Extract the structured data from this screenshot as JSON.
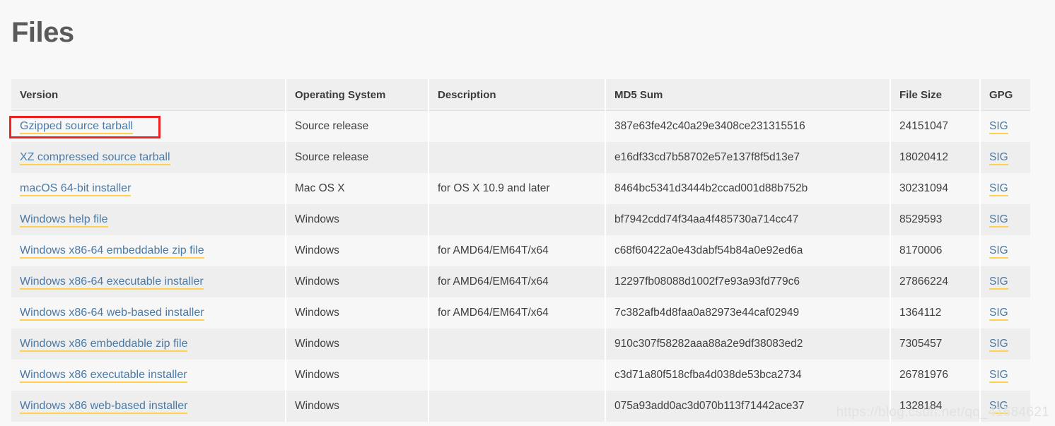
{
  "page": {
    "title": "Files",
    "watermark": "https://blog.csdn.net/qq_41684621",
    "accent_link_color": "#4b7aa5",
    "underline_color": "#ffd24d",
    "highlight_box_color": "#ee2222",
    "header_bg": "#efefef",
    "row_bg_odd": "#f7f7f7",
    "row_bg_even": "#eeeeee",
    "page_bg": "#f8f8f8"
  },
  "table": {
    "columns": [
      {
        "key": "version",
        "label": "Version"
      },
      {
        "key": "os",
        "label": "Operating System"
      },
      {
        "key": "description",
        "label": "Description"
      },
      {
        "key": "md5",
        "label": "MD5 Sum"
      },
      {
        "key": "size",
        "label": "File Size"
      },
      {
        "key": "gpg",
        "label": "GPG"
      }
    ],
    "rows": [
      {
        "version": "Gzipped source tarball",
        "os": "Source release",
        "description": "",
        "md5": "387e63fe42c40a29e3408ce231315516",
        "size": "24151047",
        "gpg": "SIG",
        "highlighted": true
      },
      {
        "version": "XZ compressed source tarball",
        "os": "Source release",
        "description": "",
        "md5": "e16df33cd7b58702e57e137f8f5d13e7",
        "size": "18020412",
        "gpg": "SIG",
        "highlighted": false
      },
      {
        "version": "macOS 64-bit installer",
        "os": "Mac OS X",
        "description": "for OS X 10.9 and later",
        "md5": "8464bc5341d3444b2ccad001d88b752b",
        "size": "30231094",
        "gpg": "SIG",
        "highlighted": false
      },
      {
        "version": "Windows help file",
        "os": "Windows",
        "description": "",
        "md5": "bf7942cdd74f34aa4f485730a714cc47",
        "size": "8529593",
        "gpg": "SIG",
        "highlighted": false
      },
      {
        "version": "Windows x86-64 embeddable zip file",
        "os": "Windows",
        "description": "for AMD64/EM64T/x64",
        "md5": "c68f60422a0e43dabf54b84a0e92ed6a",
        "size": "8170006",
        "gpg": "SIG",
        "highlighted": false
      },
      {
        "version": "Windows x86-64 executable installer",
        "os": "Windows",
        "description": "for AMD64/EM64T/x64",
        "md5": "12297fb08088d1002f7e93a93fd779c6",
        "size": "27866224",
        "gpg": "SIG",
        "highlighted": false
      },
      {
        "version": "Windows x86-64 web-based installer",
        "os": "Windows",
        "description": "for AMD64/EM64T/x64",
        "md5": "7c382afb4d8faa0a82973e44caf02949",
        "size": "1364112",
        "gpg": "SIG",
        "highlighted": false
      },
      {
        "version": "Windows x86 embeddable zip file",
        "os": "Windows",
        "description": "",
        "md5": "910c307f58282aaa88a2e9df38083ed2",
        "size": "7305457",
        "gpg": "SIG",
        "highlighted": false
      },
      {
        "version": "Windows x86 executable installer",
        "os": "Windows",
        "description": "",
        "md5": "c3d71a80f518cfba4d038de53bca2734",
        "size": "26781976",
        "gpg": "SIG",
        "highlighted": false
      },
      {
        "version": "Windows x86 web-based installer",
        "os": "Windows",
        "description": "",
        "md5": "075a93add0ac3d070b113f71442ace37",
        "size": "1328184",
        "gpg": "SIG",
        "highlighted": false
      }
    ]
  }
}
